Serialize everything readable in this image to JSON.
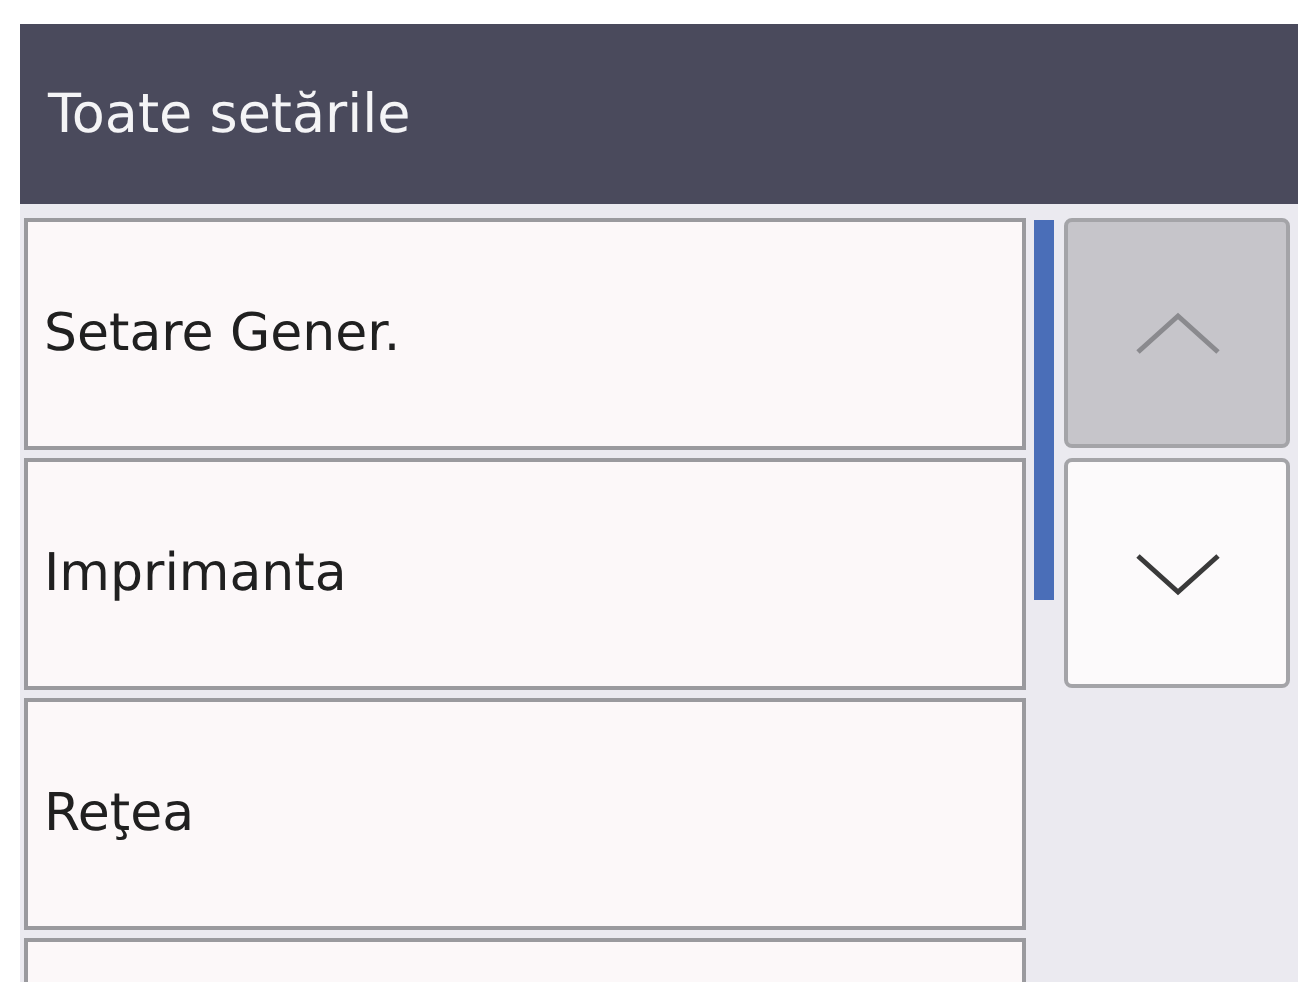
{
  "header": {
    "title": "Toate setările"
  },
  "items": [
    {
      "label": "Setare Gener."
    },
    {
      "label": "Imprimanta"
    },
    {
      "label": "Reţea"
    }
  ],
  "scroll_buttons": [
    {
      "kind": "up",
      "disabled": true
    },
    {
      "kind": "down",
      "disabled": false
    }
  ]
}
